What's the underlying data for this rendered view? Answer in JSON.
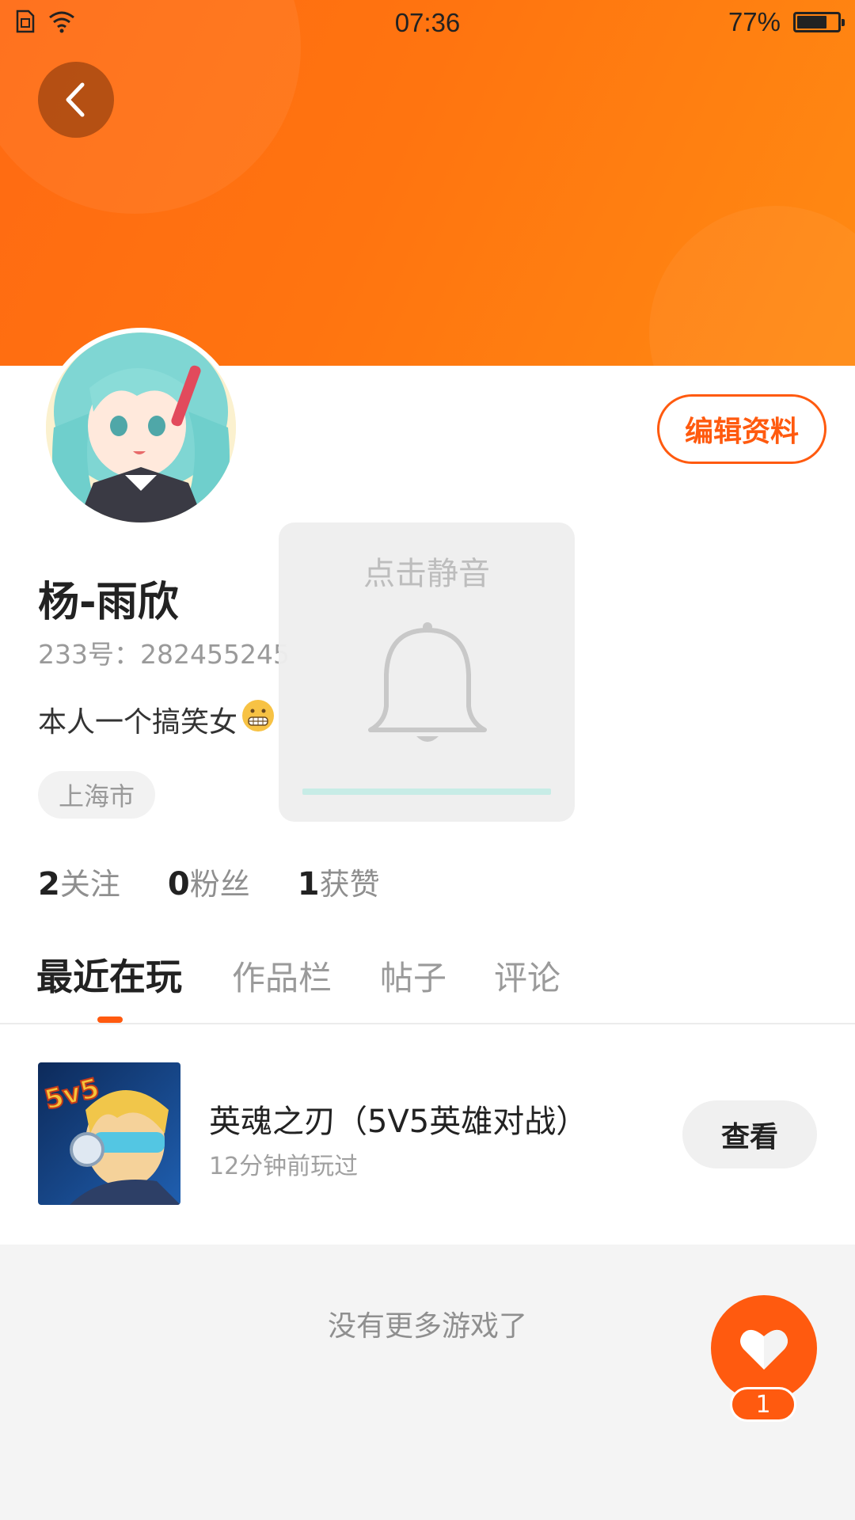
{
  "status_bar": {
    "time": "07:36",
    "battery_percent": "77%",
    "battery_level": 0.77
  },
  "profile": {
    "name": "杨-雨欣",
    "uid": "233号：282455245",
    "bio": "本人一个搞笑女",
    "location": "上海市",
    "edit_button": "编辑资料"
  },
  "stats": [
    {
      "count": "2",
      "label": "关注"
    },
    {
      "count": "0",
      "label": "粉丝"
    },
    {
      "count": "1",
      "label": "获赞"
    }
  ],
  "tabs": [
    {
      "label": "最近在玩",
      "active": true
    },
    {
      "label": "作品栏",
      "active": false
    },
    {
      "label": "帖子",
      "active": false
    },
    {
      "label": "评论",
      "active": false
    }
  ],
  "recent_games": [
    {
      "title": "英魂之刃（5V5英雄对战）",
      "subtitle": "12分钟前玩过",
      "action": "查看",
      "icon_text": "5v5"
    }
  ],
  "list_footer": "没有更多游戏了",
  "like_fab": {
    "count": "1"
  },
  "mute_toast": {
    "label": "点击静音"
  },
  "colors": {
    "accent": "#ff5a0f",
    "banner": "#ff7410",
    "progress": "#c7ece6"
  },
  "icons": {
    "back": "chevron-left-icon",
    "like": "heart-icon",
    "bell": "bell-icon"
  }
}
